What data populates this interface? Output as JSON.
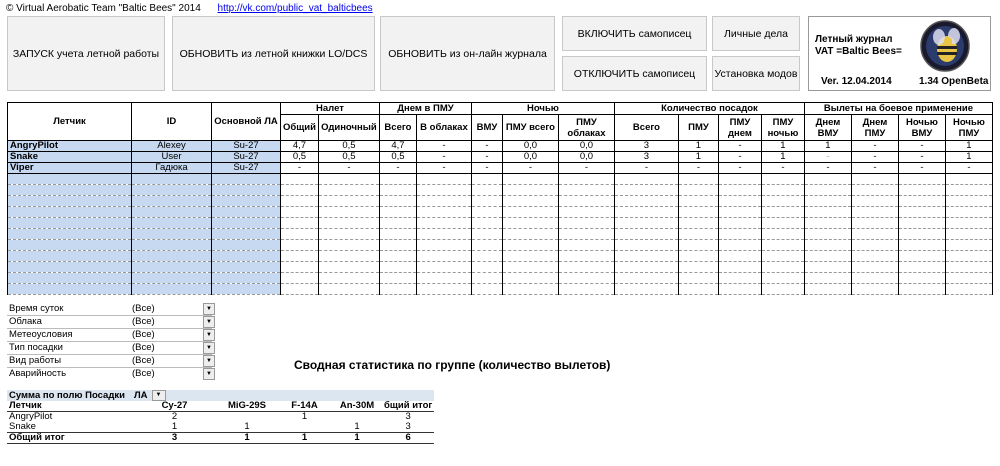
{
  "top": {
    "copyright": "© Virtual Aerobatic Team \"Baltic Bees\" 2014",
    "link": "http://vk.com/public_vat_balticbees"
  },
  "buttons": {
    "start": "ЗАПУСК учета летной работы",
    "update_lo": "ОБНОВИТЬ из летной книжки LO/DCS",
    "update_online": "ОБНОВИТЬ из он-лайн журнала",
    "recorder_on": "ВКЛЮЧИТЬ самописец",
    "recorder_off": "ОТКЛЮЧИТЬ самописец",
    "personal": "Личные дела",
    "install_mods": "Установка модов"
  },
  "logbox": {
    "title1": "Летный журнал",
    "title2": "VAT =Baltic Bees=",
    "version": "Ver. 12.04.2014",
    "build": "1.34 OpenBeta"
  },
  "table": {
    "h_pilot": "Летчик",
    "h_id": "ID",
    "h_la": "Основной ЛА",
    "groups": [
      "Налет",
      "Днем в ПМУ",
      "Ночью",
      "Количество посадок",
      "Вылеты на боевое применение"
    ],
    "sub": [
      "Общий",
      "Одиночный",
      "Всего",
      "В облаках",
      "ВМУ",
      "ПМУ всего",
      "ПМУ облаках",
      "Всего",
      "ПМУ",
      "ПМУ днем",
      "ПМУ ночью",
      "Днем ВМУ",
      "Днем ПМУ",
      "Ночью ВМУ",
      "Ночью ПМУ"
    ],
    "rows": [
      {
        "pilot": "AngryPilot",
        "id": "Alexey",
        "la": "Su-27",
        "vals": [
          "4,7",
          "0,5",
          "4,7",
          "-",
          "-",
          "0,0",
          "0,0",
          "3",
          "1",
          "-",
          "1",
          "1",
          "-",
          "-",
          "1"
        ]
      },
      {
        "pilot": "Snake",
        "id": "User",
        "la": "Su-27",
        "vals": [
          "0,5",
          "0,5",
          "0,5",
          "-",
          "-",
          "0,0",
          "0,0",
          "3",
          "1",
          "-",
          "1",
          "-",
          "-",
          "-",
          "1"
        ]
      },
      {
        "pilot": "Viper",
        "id": "Гадюка",
        "la": "Su-27",
        "vals": [
          "-",
          "-",
          "-",
          "-",
          "-",
          "-",
          "-",
          "-",
          "-",
          "-",
          "-",
          "-",
          "-",
          "-",
          "-"
        ]
      }
    ]
  },
  "filters": [
    {
      "label": "Время суток",
      "value": "(Все)"
    },
    {
      "label": "Облака",
      "value": "(Все)"
    },
    {
      "label": "Метеоусловия",
      "value": "(Все)"
    },
    {
      "label": "Тип посадки",
      "value": "(Все)"
    },
    {
      "label": "Вид работы",
      "value": "(Все)"
    },
    {
      "label": "Аварийность",
      "value": "(Все)"
    }
  ],
  "pivot": {
    "title": "Сводная статистика по группе (количество вылетов)",
    "sum_label": "Сумма по полю Посадки",
    "la_label": "ЛА",
    "pilot_label": "Летчик",
    "cols": [
      "Су-27",
      "MiG-29S",
      "F-14A",
      "An-30M",
      "бщий итог"
    ],
    "rows": [
      {
        "name": "AngryPilot",
        "vals": [
          "2",
          "",
          "1",
          "",
          "3"
        ]
      },
      {
        "name": "Snake",
        "vals": [
          "1",
          "1",
          "",
          "1",
          "3"
        ]
      }
    ],
    "total": {
      "name": "Общий итог",
      "vals": [
        "3",
        "1",
        "1",
        "1",
        "6"
      ]
    }
  }
}
